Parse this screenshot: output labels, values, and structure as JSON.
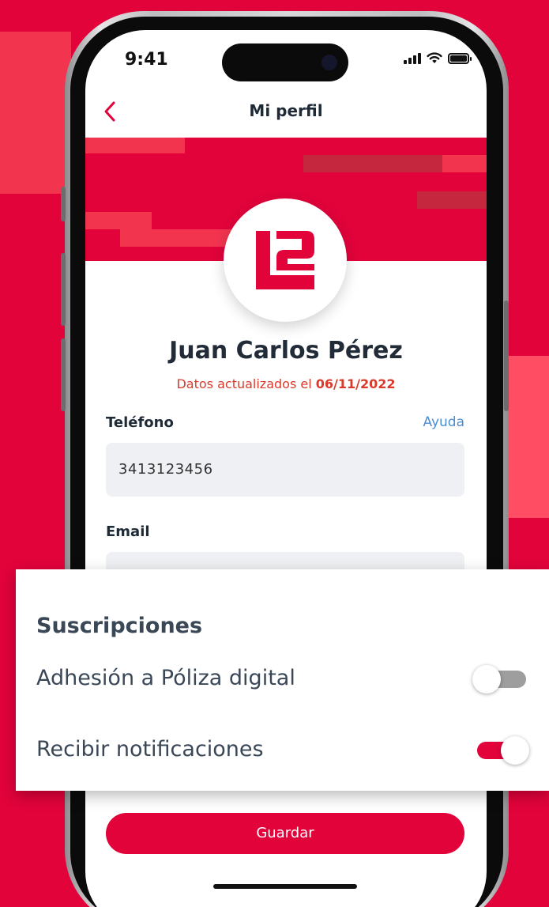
{
  "status_bar": {
    "time": "9:41"
  },
  "nav": {
    "title": "Mi perfil",
    "back_icon": "chevron-left-icon"
  },
  "profile": {
    "name": "Juan Carlos Pérez",
    "updated_prefix": "Datos actualizados el",
    "updated_date": "06/11/2022",
    "logo_icon": "l2-logo-icon"
  },
  "form": {
    "phone_label": "Teléfono",
    "help_link": "Ayuda",
    "phone_value": "3413123456",
    "email_label": "Email",
    "email_value": ""
  },
  "subscriptions": {
    "title": "Suscripciones",
    "items": [
      {
        "label": "Adhesión a Póliza digital",
        "enabled": false
      },
      {
        "label": "Recibir notificaciones",
        "enabled": true
      }
    ]
  },
  "actions": {
    "save_label": "Guardar"
  },
  "colors": {
    "brand": "#e2033b",
    "link": "#4a8ed4",
    "date_accent": "#d93a2a",
    "toggle_off": "#9e9e9e"
  }
}
